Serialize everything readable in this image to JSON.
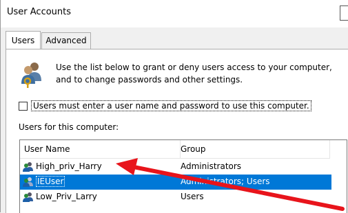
{
  "window": {
    "title": "User Accounts"
  },
  "tabs": [
    {
      "label": "Users",
      "active": true
    },
    {
      "label": "Advanced",
      "active": false
    }
  ],
  "intro": {
    "line1": "Use the list below to grant or deny users access to your computer,",
    "line2": "and to change passwords and other settings."
  },
  "require_login": {
    "label": "Users must enter a user name and password to use this computer.",
    "checked": false
  },
  "users_section_label": "Users for this computer:",
  "table": {
    "columns": [
      "User Name",
      "Group"
    ],
    "rows": [
      {
        "name": "High_priv_Harry",
        "group": "Administrators",
        "selected": false
      },
      {
        "name": "IEUser",
        "group": "Administrators; Users",
        "selected": true
      },
      {
        "name": "Low_Priv_Larry",
        "group": "Users",
        "selected": false
      }
    ]
  },
  "annotation": {
    "arrow_color": "#e8141b",
    "points_to": "High_priv_Harry"
  },
  "colors": {
    "selection": "#0078d7",
    "panel": "#ffffff",
    "background": "#f0f0f0"
  }
}
